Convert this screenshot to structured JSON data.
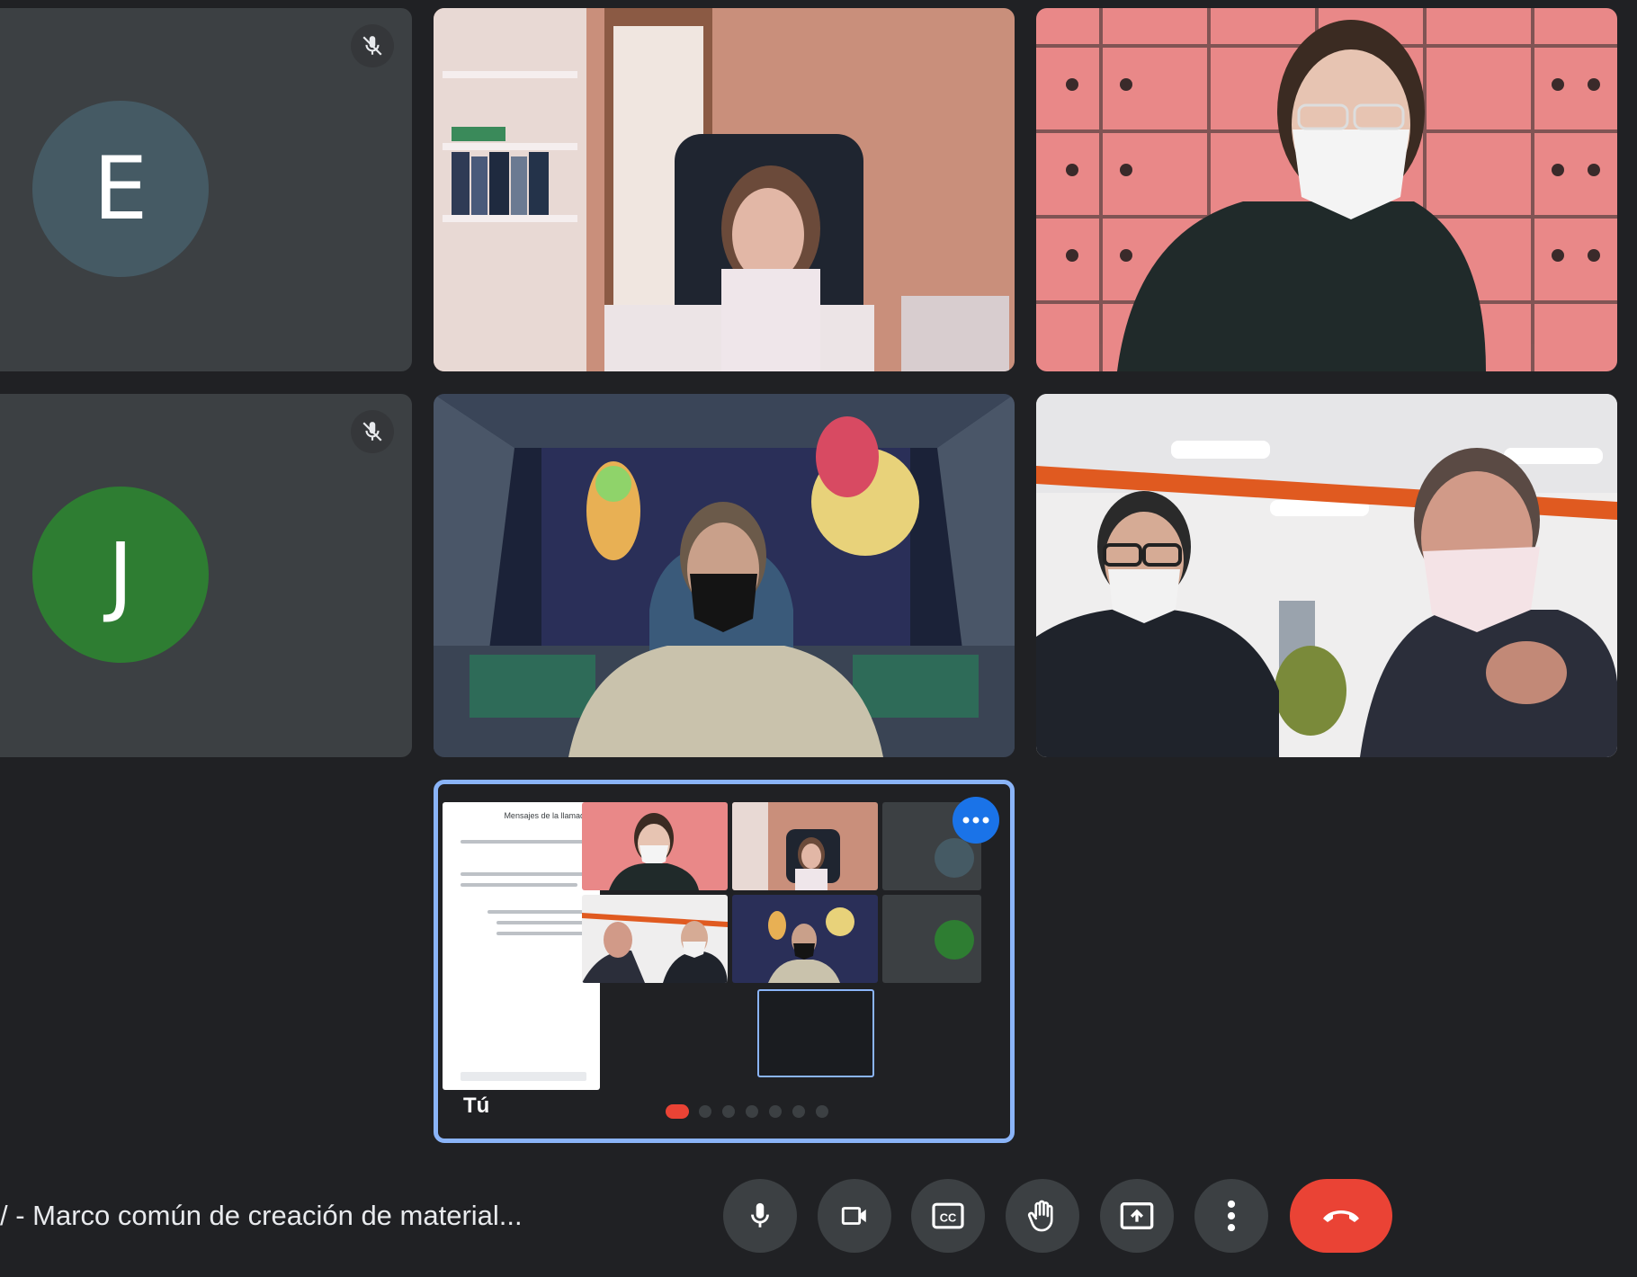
{
  "participants": [
    {
      "initial": "E",
      "color": "#455a64",
      "muted": true
    },
    {
      "initial": "J",
      "color": "#2e7d32",
      "muted": true
    }
  ],
  "self_view": {
    "label": "Tú",
    "chat_title": "Mensajes de la llamada"
  },
  "meeting": {
    "title": "/ - Marco común de creación de material..."
  },
  "controls": [
    {
      "icon": "microphone-icon"
    },
    {
      "icon": "camera-icon"
    },
    {
      "icon": "captions-icon"
    },
    {
      "icon": "raise-hand-icon"
    },
    {
      "icon": "present-screen-icon"
    },
    {
      "icon": "more-options-icon"
    },
    {
      "icon": "end-call-icon"
    }
  ],
  "colors": {
    "background": "#202124",
    "tile": "#3c4043",
    "accent": "#8ab4f8",
    "end_call": "#ea4335"
  }
}
